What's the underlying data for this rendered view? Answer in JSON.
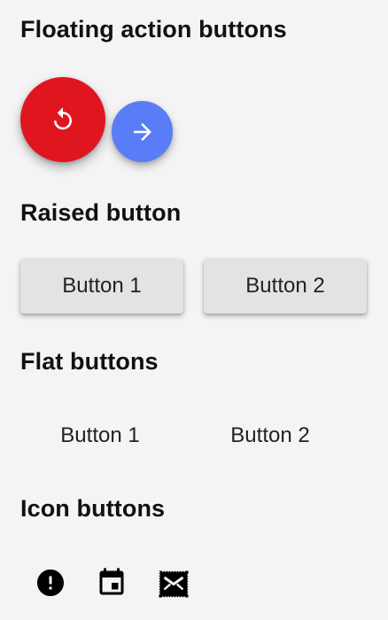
{
  "sections": {
    "fab_title": "Floating action buttons",
    "raised_title": "Raised button",
    "flat_title": "Flat buttons",
    "icon_title": "Icon buttons"
  },
  "fab": {
    "primary": {
      "icon": "replay-icon",
      "color": "#e0161f"
    },
    "secondary": {
      "icon": "arrow-forward-icon",
      "color": "#5b7cf7"
    }
  },
  "raised_buttons": [
    {
      "label": "Button 1",
      "color": "#e3e3e3"
    },
    {
      "label": "Button 2",
      "color": "#e3e3e3"
    }
  ],
  "flat_buttons": [
    {
      "label": "Button 1"
    },
    {
      "label": "Button 2"
    }
  ],
  "icon_buttons": [
    {
      "icon": "alert-circle-icon"
    },
    {
      "icon": "calendar-today-icon"
    },
    {
      "icon": "stamp-mail-icon"
    }
  ],
  "colors": {
    "background": "#f4f4f4",
    "text": "#111111",
    "icon": "#000000"
  }
}
